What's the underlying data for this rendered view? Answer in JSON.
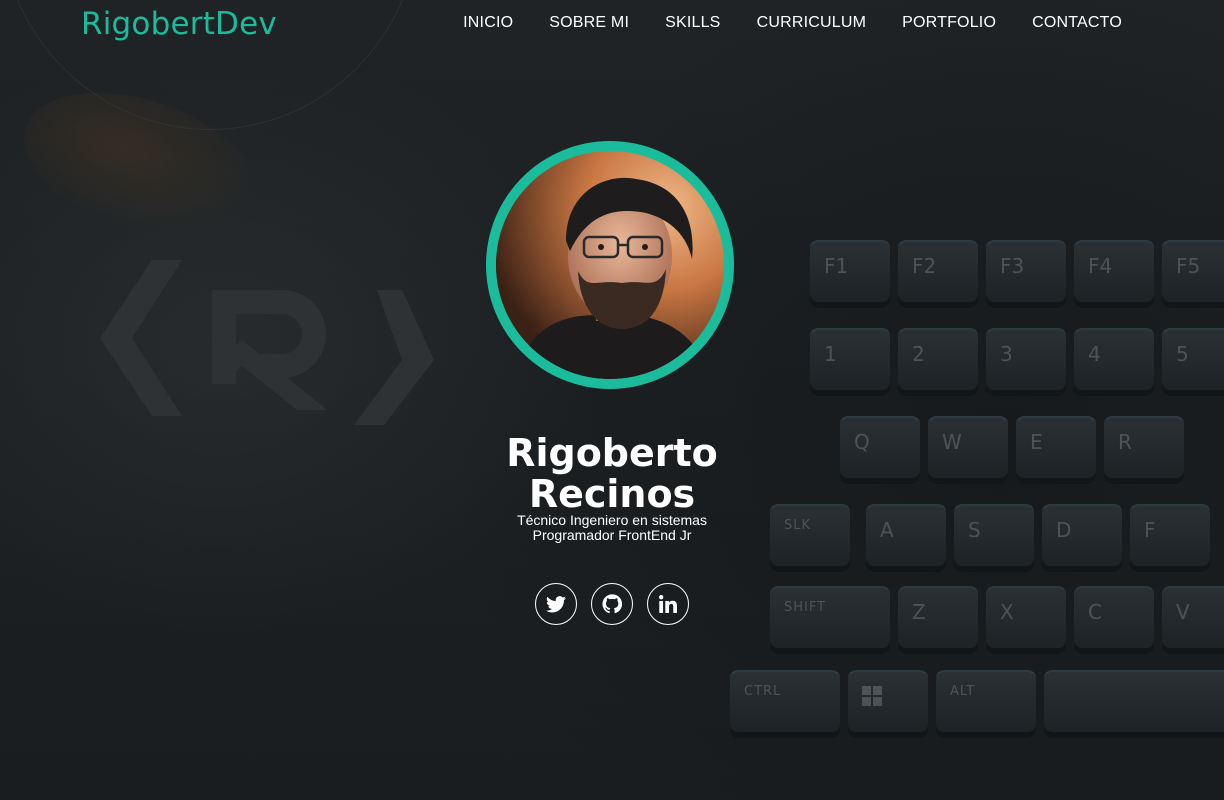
{
  "header": {
    "brand": "RigobertDev",
    "nav": [
      {
        "label": "INICIO"
      },
      {
        "label": "SOBRE MI"
      },
      {
        "label": "SKILLS"
      },
      {
        "label": "CURRICULUM"
      },
      {
        "label": "PORTFOLIO"
      },
      {
        "label": "CONTACTO"
      }
    ]
  },
  "hero": {
    "name_line1": "Rigoberto",
    "name_line2": "Recinos",
    "subtitle_line1": "Técnico Ingeniero en sistemas",
    "subtitle_line2": "Programador FrontEnd Jr",
    "avatar_alt": "profile-photo",
    "social": [
      {
        "icon": "twitter-icon"
      },
      {
        "icon": "github-icon"
      },
      {
        "icon": "linkedin-icon"
      }
    ]
  },
  "background": {
    "keys": [
      "F1",
      "F2",
      "F3",
      "F4",
      "F5",
      "1",
      "2",
      "3",
      "4",
      "5",
      "Q",
      "W",
      "E",
      "R",
      "SLK",
      "A",
      "S",
      "D",
      "F",
      "SHIFT",
      "Z",
      "X",
      "C",
      "V",
      "CTRL",
      "ALT"
    ]
  },
  "colors": {
    "accent": "#1abc9c",
    "background": "#1e2224",
    "text": "#ffffff"
  }
}
